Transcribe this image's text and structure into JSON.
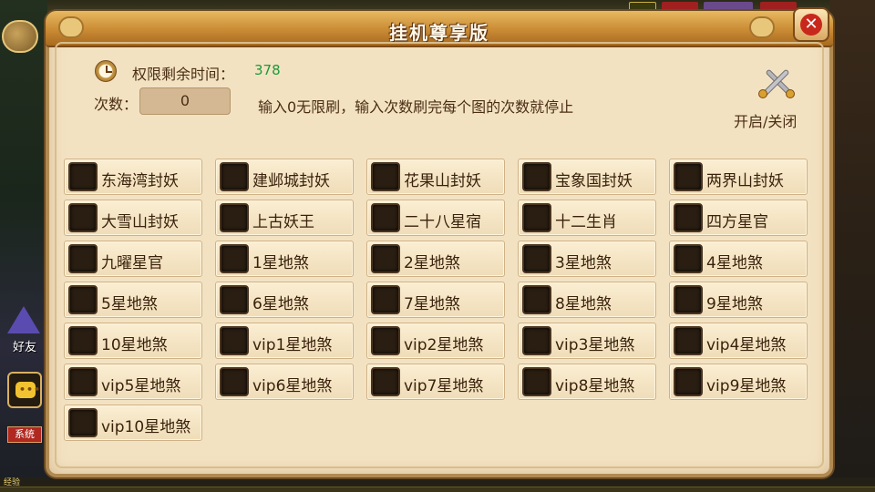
{
  "dialog": {
    "title": "挂机尊享版",
    "close_symbol": "✕",
    "time_label": "权限剩余时间：",
    "time_value": "378",
    "count_label": "次数：",
    "count_value": "0",
    "hint": "输入0无限刷，输入次数刷完每个图的次数就停止",
    "toggle_label": "开启/关闭",
    "options": [
      "东海湾封妖",
      "建邺城封妖",
      "花果山封妖",
      "宝象国封妖",
      "两界山封妖",
      "大雪山封妖",
      "上古妖王",
      "二十八星宿",
      "十二生肖",
      "四方星官",
      "九曜星官",
      "1星地煞",
      "2星地煞",
      "3星地煞",
      "4星地煞",
      "5星地煞",
      "6星地煞",
      "7星地煞",
      "8星地煞",
      "9星地煞",
      "10星地煞",
      "vip1星地煞",
      "vip2星地煞",
      "vip3星地煞",
      "vip4星地煞",
      "vip5星地煞",
      "vip6星地煞",
      "vip7星地煞",
      "vip8星地煞",
      "vip9星地煞",
      "vip10星地煞"
    ]
  },
  "sidebar": {
    "friend_label": "好友",
    "system_label": "系统"
  },
  "footer": {
    "exp_label": "经验"
  },
  "icons": {
    "clock": "clock-icon",
    "toggle": "crossed-swords-icon",
    "close": "close-icon",
    "chat": "chat-bubble-icon"
  },
  "colors": {
    "panel_bg": "#f3e2c2",
    "title_bar": "#c98b34",
    "time_value": "#1a9a3a",
    "close_red": "#c8281c",
    "checkbox": "#2a1e12"
  }
}
